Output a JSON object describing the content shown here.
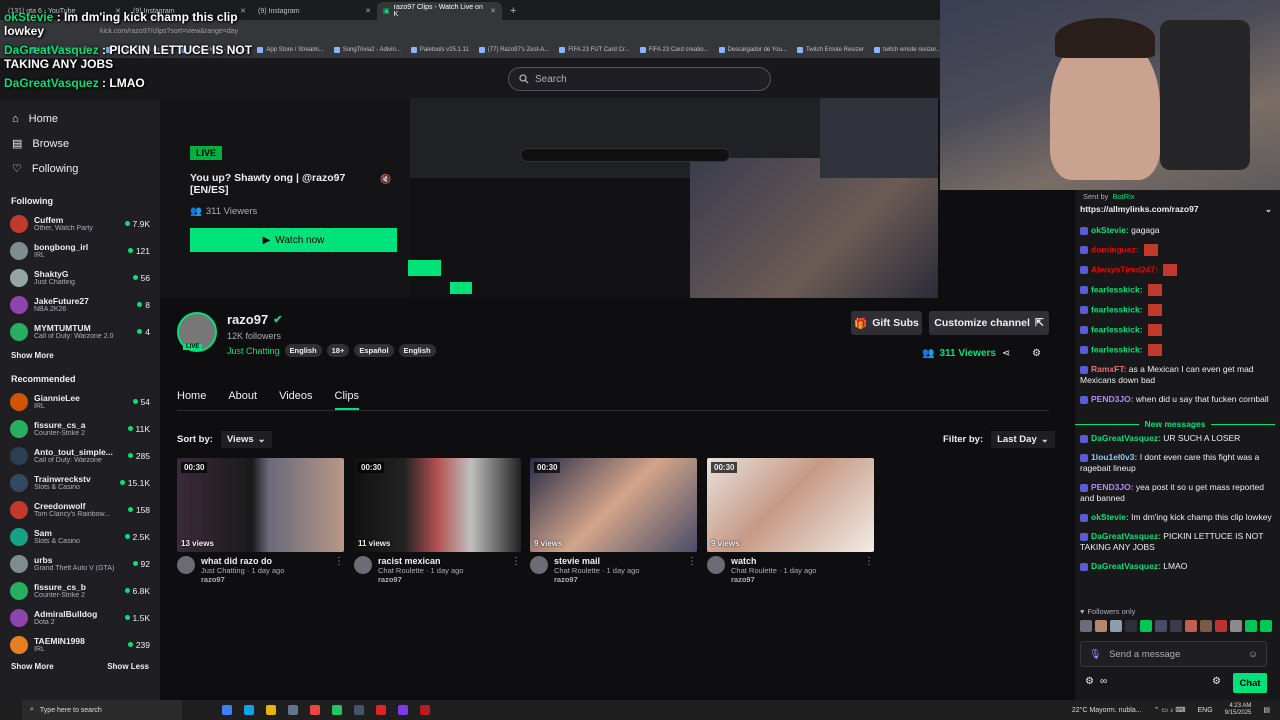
{
  "browser": {
    "tabs": [
      {
        "label": "(131) gta 6 - YouTube"
      },
      {
        "label": "(9) Instagram"
      },
      {
        "label": "(9) Instagram"
      },
      {
        "label": "razo97 Clips - Watch Live on K"
      }
    ],
    "address": "kick.com/razo97/clips?sort=view&range=day",
    "bookmarks": [
      "Happy Cristiano Ro...",
      "Borago figura de te...",
      "SongTrivia2 - Test y...",
      "App Store / Streami...",
      "SongTrivia2 - Adivin...",
      "Paletools v25.1.11",
      "(77) Razo97's Zest-A...",
      "FIFA 23 FUT Card Cr...",
      "FIFA 23 Card creatio...",
      "Descargador de You...",
      "Twitch Emote Resizer",
      "twitch emote resizer..."
    ]
  },
  "overlay_chat": [
    {
      "user": "okStevie",
      "msg": "Im dm'ing kick champ this clip lowkey"
    },
    {
      "user": "DaGreatVasquez",
      "msg": "PICKIN LETTUCE IS NOT TAKING ANY JOBS"
    },
    {
      "user": "DaGreatVasquez",
      "msg": "LMAO"
    }
  ],
  "header": {
    "search_placeholder": "Search"
  },
  "sidebar": {
    "nav": [
      {
        "label": "Home"
      },
      {
        "label": "Browse"
      },
      {
        "label": "Following"
      }
    ],
    "following_title": "Following",
    "following": [
      {
        "name": "Cuffem",
        "game": "Other, Watch Party",
        "count": "7.9K",
        "color": "#c0392b"
      },
      {
        "name": "bongbong_irl",
        "game": "IRL",
        "count": "121",
        "color": "#7f8c8d"
      },
      {
        "name": "ShaktyG",
        "game": "Just Chatting",
        "count": "56",
        "color": "#95a5a6"
      },
      {
        "name": "JakeFuture27",
        "game": "NBA 2K26",
        "count": "8",
        "color": "#8e44ad"
      },
      {
        "name": "MYMTUMTUM",
        "game": "Call of Duty: Warzone 2.0",
        "count": "4",
        "color": "#27ae60"
      }
    ],
    "show_more": "Show More",
    "recommended_title": "Recommended",
    "recommended": [
      {
        "name": "GiannieLee",
        "game": "IRL",
        "count": "54",
        "color": "#d35400"
      },
      {
        "name": "fissure_cs_a",
        "game": "Counter-Strike 2",
        "count": "11K",
        "color": "#27ae60"
      },
      {
        "name": "Anto_tout_simple...",
        "game": "Call of Duty: Warzone",
        "count": "285",
        "color": "#2c3e50"
      },
      {
        "name": "Trainwreckstv",
        "game": "Slots & Casino",
        "count": "15.1K",
        "color": "#34495e"
      },
      {
        "name": "Creedonwolf",
        "game": "Tom Clancy's Rainbow...",
        "count": "158",
        "color": "#c0392b"
      },
      {
        "name": "Sam",
        "game": "Slots & Casino",
        "count": "2.5K",
        "color": "#16a085"
      },
      {
        "name": "urbs",
        "game": "Grand Theft Auto V (GTA)",
        "count": "92",
        "color": "#7f8c8d"
      },
      {
        "name": "fissure_cs_b",
        "game": "Counter-Strike 2",
        "count": "6.8K",
        "color": "#27ae60"
      },
      {
        "name": "AdmiralBulldog",
        "game": "Dota 2",
        "count": "1.5K",
        "color": "#8e44ad"
      },
      {
        "name": "TAEMIN1998",
        "game": "IRL",
        "count": "239",
        "color": "#e67e22"
      }
    ],
    "show_more_2": "Show More",
    "show_less": "Show Less"
  },
  "hero": {
    "live": "LIVE",
    "title": "You up? Shawty ong | @razo97 [EN/ES]",
    "viewers": "311 Viewers",
    "watch": "Watch now"
  },
  "channel": {
    "name": "razo97",
    "followers": "12K followers",
    "category": "Just Chatting",
    "tags": [
      "English",
      "18+",
      "Español",
      "English"
    ],
    "live_badge": "LIVE",
    "gift_subs": "Gift Subs",
    "customize": "Customize channel",
    "viewers": "311 Viewers"
  },
  "tabs": [
    {
      "label": "Home"
    },
    {
      "label": "About"
    },
    {
      "label": "Videos"
    },
    {
      "label": "Clips"
    }
  ],
  "filters": {
    "sort_label": "Sort by:",
    "sort_value": "Views",
    "filter_label": "Filter by:",
    "filter_value": "Last Day"
  },
  "clips": [
    {
      "duration": "00:30",
      "views": "13 views",
      "title": "what did razo do",
      "meta": "Just Chatting · 1 day ago",
      "author": "razo97"
    },
    {
      "duration": "00:30",
      "views": "11 views",
      "title": "racist mexican",
      "meta": "Chat Roulette · 1 day ago",
      "author": "razo97"
    },
    {
      "duration": "00:30",
      "views": "9 views",
      "title": "stevie mail",
      "meta": "Chat Roulette · 1 day ago",
      "author": "razo97"
    },
    {
      "duration": "00:30",
      "views": "9 views",
      "title": "watch",
      "meta": "Chat Roulette · 1 day ago",
      "author": "razo97"
    }
  ],
  "chat": {
    "pinned_by": "Sent by",
    "pinned_user": "BotRix",
    "pinned_link": "https://allmylinks.com/razo97",
    "messages": [
      {
        "user": "okStevie",
        "msg": "gagaga",
        "color": "#00e37a"
      },
      {
        "user": "dominguez",
        "msg": "",
        "color": "#eb0400"
      },
      {
        "user": "AlwaysTired247",
        "msg": "",
        "color": "#eb0400"
      },
      {
        "user": "fearlesskick",
        "msg": "",
        "color": "#00e37a"
      },
      {
        "user": "fearlesskick",
        "msg": "",
        "color": "#00e37a"
      },
      {
        "user": "fearlesskick",
        "msg": "",
        "color": "#00e37a"
      },
      {
        "user": "fearlesskick",
        "msg": "",
        "color": "#00e37a"
      },
      {
        "user": "RamxFT",
        "msg": "as a Mexican I can even get mad Mexicans down bad",
        "color": "#e57373"
      },
      {
        "user": "PEND3JO",
        "msg": "when did u say that fucken cornball",
        "color": "#b388ff"
      }
    ],
    "new_messages": "New messages",
    "new": [
      {
        "user": "DaGreatVasquez",
        "msg": "UR SUCH A LOSER",
        "color": "#00e37a"
      },
      {
        "user": "1lou1el0v3",
        "msg": "I dont even care this fight was a ragebait lineup",
        "color": "#90caf9"
      },
      {
        "user": "PEND3JO",
        "msg": "yea post it so u get mass reported and banned",
        "color": "#b388ff"
      },
      {
        "user": "okStevie",
        "msg": "Im dm'ing kick champ this clip lowkey",
        "color": "#00e37a"
      },
      {
        "user": "DaGreatVasquez",
        "msg": "PICKIN LETTUCE IS NOT TAKING ANY JOBS",
        "color": "#00e37a"
      },
      {
        "user": "DaGreatVasquez",
        "msg": "LMAO",
        "color": "#00e37a"
      }
    ],
    "followers_only": "Followers only",
    "placeholder": "Send a message",
    "chat_button": "Chat"
  },
  "taskbar": {
    "search": "Type here to search",
    "weather": "22°C  Mayorm. nubla...",
    "lang": "ENG",
    "time": "4:23 AM",
    "date": "9/15/2025"
  }
}
